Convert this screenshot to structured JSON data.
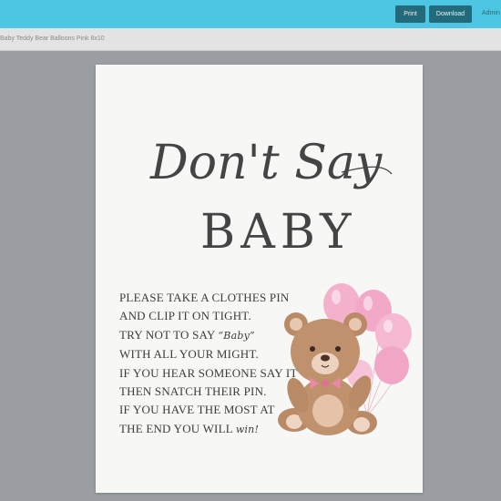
{
  "toolbar": {
    "print_label": "Print",
    "download_label": "Download",
    "admin_label": "Admin"
  },
  "path": {
    "title": "Baby Teddy Bear Balloons Pink 8x10"
  },
  "sign": {
    "heading_script": "Don't Say",
    "heading_main": "BABY",
    "lines": [
      "PLEASE TAKE A CLOTHES PIN",
      "AND CLIP IT ON TIGHT.",
      "WITH ALL YOUR MIGHT.",
      "IF YOU HEAR SOMEONE SAY IT",
      "THEN SNATCH THEIR PIN.",
      "IF YOU HAVE THE MOST AT"
    ],
    "line3_prefix": "TRY NOT TO SAY ",
    "line3_script": "“Baby”",
    "last_prefix": "THE END YOU WILL ",
    "last_script": "win!"
  },
  "colors": {
    "topbar": "#4dc6e3",
    "button": "#236a7a",
    "balloon": "#f2a9c8",
    "bear": "#b98a66"
  }
}
